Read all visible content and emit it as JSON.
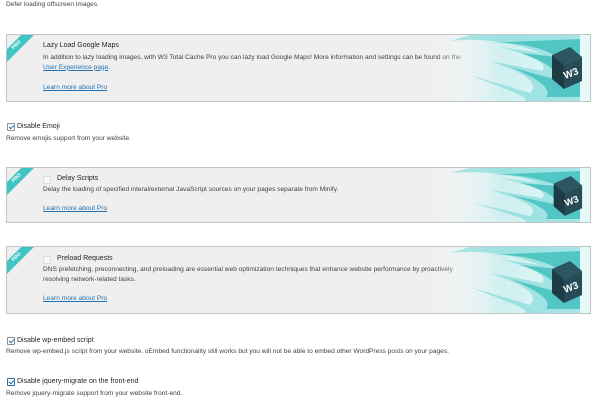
{
  "top_text": "Defer loading offscreen images.",
  "promo_badge": "PRO",
  "logo_text": "W3",
  "lazy_maps": {
    "title": "Lazy Load Google Maps",
    "desc_before_link": "In addition to lazy loading images, with W3 Total Cache Pro you can lazy load Google Maps! More information and settings can be found on the ",
    "desc_link": "User Experience page",
    "desc_after_link": ".",
    "learn_more": "Learn more about Pro"
  },
  "disable_emoji": {
    "label": "Disable Emoji",
    "checked": true,
    "desc": "Remove emojis support from your website."
  },
  "delay_scripts": {
    "title": "Delay Scripts",
    "desc": "Delay the loading of specified interal/external JavaScript sources on your pages separate from Minify.",
    "learn_more": "Learn more about Pro"
  },
  "preload_requests": {
    "title": "Preload Requests",
    "desc": "DNS prefetching, preconnecting, and preloading are essential web optimization techniques that enhance website performance by proactively resolving network-related tasks.",
    "learn_more": "Learn more about Pro"
  },
  "disable_wp_embed": {
    "label": "Disable wp-embed script",
    "checked": true,
    "desc": "Remove wp-embed.js script from your website. oEmbed functionality still works but you will not be able to embed other WordPress posts on your pages."
  },
  "disable_jquery_migrate": {
    "label": "Disable jquery-migrate on the front-end",
    "checked": true,
    "desc": "Remove jquery-migrate support from your website front-end."
  },
  "colors": {
    "accent": "#2271b1",
    "pro_teal": "#3fc6c4",
    "logo_dark": "#1e3a44"
  }
}
